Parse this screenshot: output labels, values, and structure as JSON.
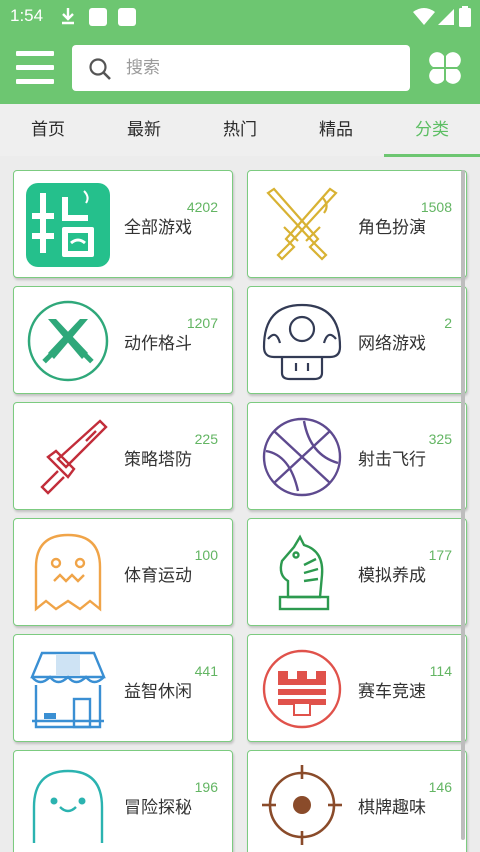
{
  "status": {
    "time": "1:54"
  },
  "search": {
    "placeholder": "搜索"
  },
  "tabs": [
    {
      "label": "首页",
      "active": false
    },
    {
      "label": "最新",
      "active": false
    },
    {
      "label": "热门",
      "active": false
    },
    {
      "label": "精品",
      "active": false
    },
    {
      "label": "分类",
      "active": true
    }
  ],
  "colors": {
    "brand": "#6dc671",
    "accent": "#5cbe63",
    "card_border": "#7ccb80"
  },
  "categories": [
    {
      "name": "全部游戏",
      "count": "4202",
      "icon": "all-games-icon"
    },
    {
      "name": "角色扮演",
      "count": "1508",
      "icon": "crossed-swords-icon"
    },
    {
      "name": "动作格斗",
      "count": "1207",
      "icon": "action-swords-icon"
    },
    {
      "name": "网络游戏",
      "count": "2",
      "icon": "mushroom-icon"
    },
    {
      "name": "策略塔防",
      "count": "225",
      "icon": "sword-icon"
    },
    {
      "name": "射击飞行",
      "count": "325",
      "icon": "basketball-icon"
    },
    {
      "name": "体育运动",
      "count": "100",
      "icon": "ghost-icon"
    },
    {
      "name": "模拟养成",
      "count": "177",
      "icon": "chess-knight-icon"
    },
    {
      "name": "益智休闲",
      "count": "441",
      "icon": "shop-icon"
    },
    {
      "name": "赛车竞速",
      "count": "114",
      "icon": "castle-icon"
    },
    {
      "name": "冒险探秘",
      "count": "196",
      "icon": "blob-face-icon"
    },
    {
      "name": "棋牌趣味",
      "count": "146",
      "icon": "target-icon"
    }
  ]
}
